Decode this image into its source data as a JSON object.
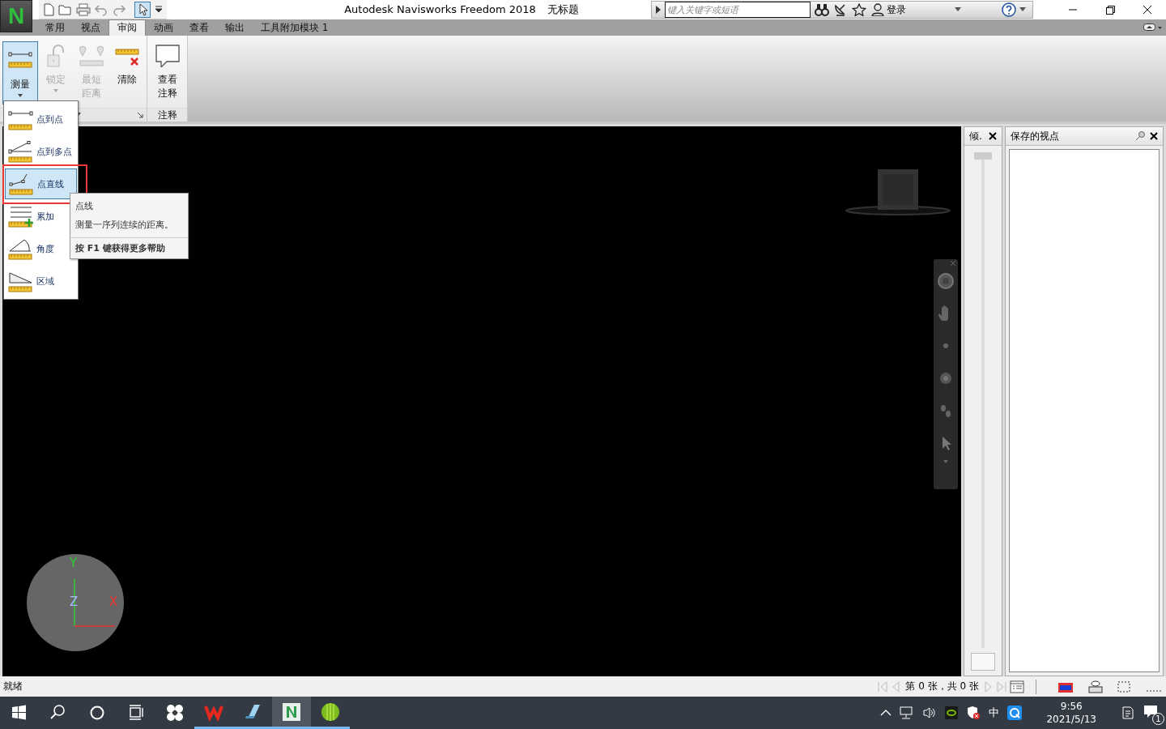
{
  "app_button": {
    "label": "N"
  },
  "title": "Autodesk Navisworks Freedom 2018",
  "document": "无标题",
  "search": {
    "placeholder": "键入关键字或短语"
  },
  "sign_in": "登录",
  "ribbon_tabs": [
    {
      "label": "常用",
      "selected": false
    },
    {
      "label": "视点",
      "selected": false
    },
    {
      "label": "审阅",
      "selected": true
    },
    {
      "label": "动画",
      "selected": false
    },
    {
      "label": "查看",
      "selected": false
    },
    {
      "label": "输出",
      "selected": false
    },
    {
      "label": "工具附加模块 1",
      "selected": false
    }
  ],
  "ribbon_panels": [
    {
      "buttons": [
        {
          "label": "测量",
          "kind": "measure",
          "disabled": false,
          "pressed": true,
          "has_menu": true
        },
        {
          "label": "锁定",
          "kind": "lock",
          "disabled": true,
          "pressed": false,
          "has_menu": true
        },
        {
          "label": "最短距离",
          "kind": "shortest",
          "disabled": true,
          "pressed": false,
          "has_menu": false
        },
        {
          "label": "清除",
          "kind": "clear",
          "disabled": false,
          "pressed": false,
          "has_menu": false
        }
      ]
    },
    {
      "title": "注释",
      "buttons": [
        {
          "label": "查看注释",
          "kind": "comment",
          "disabled": false,
          "pressed": false,
          "has_menu": false
        }
      ]
    }
  ],
  "measure_menu": [
    {
      "label": "点到点",
      "kind": "point-to-point",
      "selected": false
    },
    {
      "label": "点到多点",
      "kind": "point-to-multiple",
      "selected": false
    },
    {
      "label": "点直线",
      "kind": "point-line",
      "selected": true
    },
    {
      "label": "累加",
      "kind": "accumulate",
      "selected": false
    },
    {
      "label": "角度",
      "kind": "angle",
      "selected": false
    },
    {
      "label": "区域",
      "kind": "area",
      "selected": false
    }
  ],
  "tooltip": {
    "title": "点线",
    "description": "测量一序列连续的距离。",
    "help": "按 F1 键获得更多帮助"
  },
  "axes": [
    {
      "label": "Y",
      "kind": "y"
    },
    {
      "label": "Z",
      "kind": "z"
    },
    {
      "label": "X",
      "kind": "x"
    }
  ],
  "tilt_panel": {
    "title": "倾.",
    "level": 0
  },
  "saved_viewpoints": {
    "title": "保存的视点"
  },
  "status_bar": {
    "text": "就绪",
    "sheet": "第 0 张，共 0 张"
  },
  "taskbar": {
    "apps": [
      {
        "kind": "start",
        "running": false,
        "active": false
      },
      {
        "kind": "search",
        "running": false,
        "active": false
      },
      {
        "kind": "cortana",
        "running": false,
        "active": false
      },
      {
        "kind": "taskview",
        "running": false,
        "active": false
      },
      {
        "kind": "pinwheel",
        "running": false,
        "active": false
      },
      {
        "kind": "wps",
        "running": true,
        "active": false
      },
      {
        "kind": "notepad",
        "running": true,
        "active": false
      },
      {
        "kind": "navisworks",
        "running": true,
        "active": true
      },
      {
        "kind": "melon",
        "running": true,
        "active": false
      }
    ],
    "ime": "中",
    "time": "9:56",
    "date": "2021/5/13",
    "notifications": "1"
  }
}
